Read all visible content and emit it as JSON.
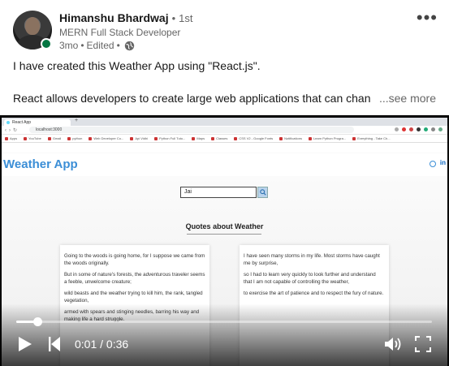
{
  "author": {
    "name": "Himanshu Bhardwaj",
    "separator": "•",
    "degree": "1st",
    "headline": "MERN Full Stack Developer",
    "time": "3mo",
    "edited": "Edited"
  },
  "post": {
    "line1": "I have created this Weather App using \"React.js\".",
    "line2": "React allows developers to create large web applications that can change",
    "see_more": "...see more"
  },
  "video": {
    "progress_percent": 5,
    "time_label": "0:01 / 0:36",
    "screen": {
      "tab_title": "React App",
      "url": "localhost:3000",
      "bookmarks": [
        "Apps",
        "YouTube",
        "Gmail",
        "python",
        "Web Developer Co...",
        "Api Vidhi",
        "Python Full Tuto...",
        "Maps",
        "Classes",
        "CSS V2 - Google Fonts",
        "Notifications",
        "Learn Python Progra...",
        "Everything - Take Ch..."
      ],
      "app_title": "Weather App",
      "search_value": "Jai",
      "quotes_heading": "Quotes about Weather",
      "left_quote": [
        "Going to the woods is going home, for I suppose we came from the woods originally.",
        "But in some of nature's forests, the adventurous traveler seems a feeble, unwelcome creature;",
        "wild beasts and the weather trying to kill him, the rank, tangled vegetation,",
        "armed with spears and stinging needles, barring his way and making life a hard struggle."
      ],
      "right_quote": [
        "I have seen many storms in my life. Most storms have caught me by surprise,",
        "so I had to learn very quickly to look further and understand that I am not capable of controlling the weather,",
        "to exercise the art of patience and to respect the fury of nature."
      ]
    }
  },
  "colors": {
    "online": "#057642",
    "app_accent": "#3b8ed6"
  }
}
